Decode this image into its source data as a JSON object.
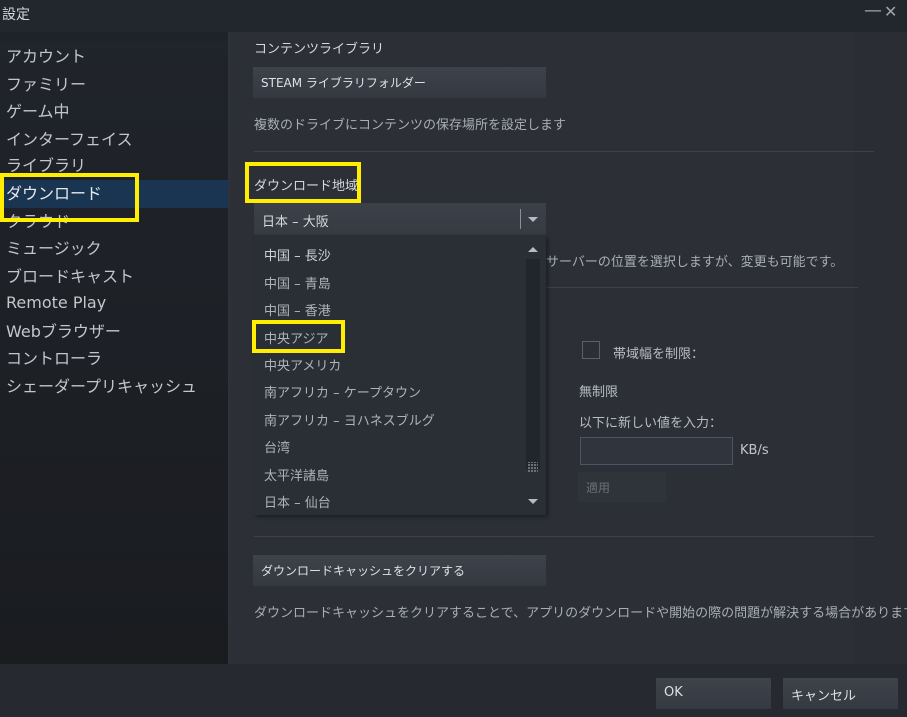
{
  "window": {
    "title": "設定",
    "minimize_icon": "—",
    "close_icon": "✕"
  },
  "sidebar": {
    "items": [
      {
        "label": "アカウント"
      },
      {
        "label": "ファミリー"
      },
      {
        "label": "ゲーム中"
      },
      {
        "label": "インターフェイス"
      },
      {
        "label": "ライブラリ"
      },
      {
        "label": "ダウンロード",
        "active": true
      },
      {
        "label": "クラウド"
      },
      {
        "label": "ミュージック"
      },
      {
        "label": "ブロードキャスト"
      },
      {
        "label": "Remote Play"
      },
      {
        "label": "Webブラウザー"
      },
      {
        "label": "コントローラ"
      },
      {
        "label": "シェーダープリキャッシュ"
      }
    ]
  },
  "content_library": {
    "heading": "コンテンツライブラリ",
    "button_label": "STEAM ライブラリフォルダー",
    "description": "複数のドライブにコンテンツの保存場所を設定します"
  },
  "download_region": {
    "heading": "ダウンロード地域",
    "selected": "日本 – 大阪",
    "description_visible": "サーバーの位置を選択しますが、変更も可能です。",
    "options": [
      "中国 – 長沙",
      "中国 – 青島",
      "中国 – 香港",
      "中央アジア",
      "中央アメリカ",
      "南アフリカ – ケープタウン",
      "南アフリカ – ヨハネスブルグ",
      "台湾",
      "太平洋諸島",
      "日本 – 仙台"
    ]
  },
  "bandwidth": {
    "checkbox_label": "帯域幅を制限：",
    "checked": false,
    "current": "無制限",
    "input_label": "以下に新しい値を入力：",
    "input_value": "",
    "unit": "KB/s",
    "apply_label": "適用"
  },
  "cache": {
    "button_label": "ダウンロードキャッシュをクリアする",
    "description": "ダウンロードキャッシュをクリアすることで、アプリのダウンロードや開始の際の問題が解決する場合があります。"
  },
  "footer": {
    "ok_label": "OK",
    "cancel_label": "キャンセル"
  },
  "colors": {
    "highlight": "#ffee00",
    "active_nav": "#1a3552"
  }
}
